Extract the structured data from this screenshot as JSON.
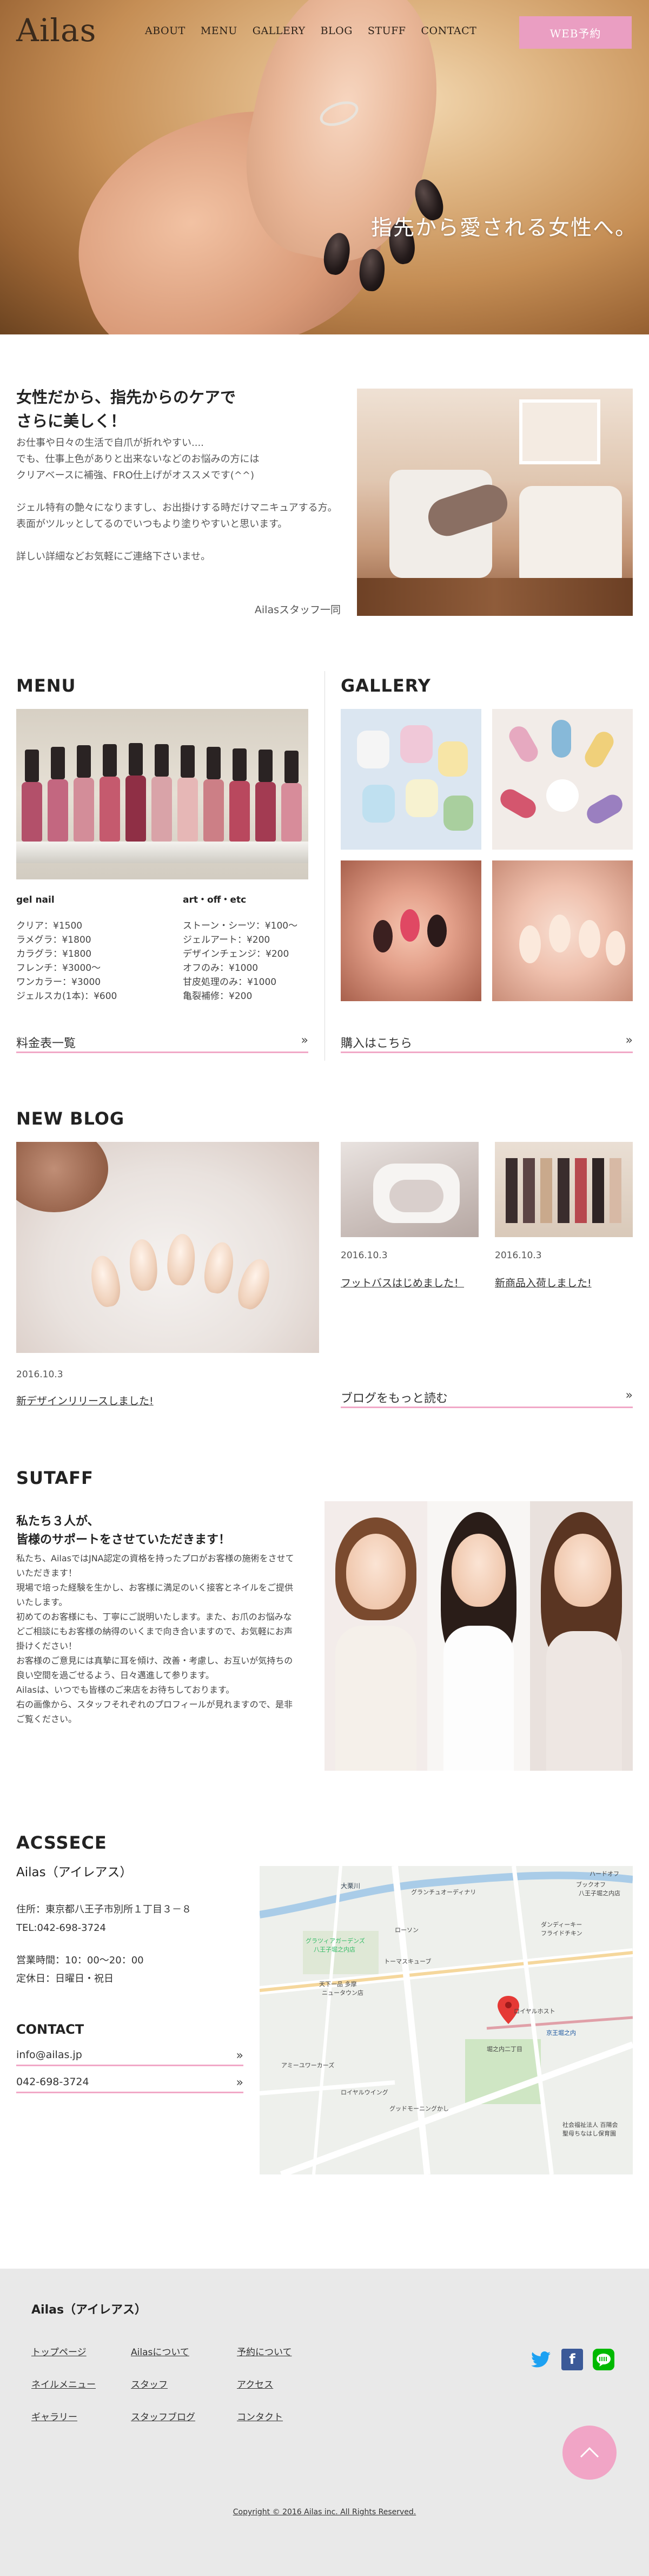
{
  "header": {
    "logo": "Ailas",
    "nav": [
      "ABOUT",
      "MENU",
      "GALLERY",
      "BLOG",
      "STUFF",
      "CONTACT"
    ],
    "reserve_button": "WEB予約"
  },
  "hero": {
    "tagline": "指先から愛される女性へ。"
  },
  "intro": {
    "title_line1": "女性だから、指先からのケアで",
    "title_line2": "さらに美しく！",
    "p1": "お仕事や日々の生活で自爪が折れやすい....\nでも、仕事上色がありと出来ないなどのお悩みの方には\nクリアベースに補強、FRO仕上げがオススメです(^^)",
    "p2": "ジェル特有の艶々になりますし、お出掛けする時だけマニキュアする方。表面がツルッとしてるのでいつもより塗りやすいと思います。",
    "p3": "詳しい詳細などお気軽にご連絡下さいませ。",
    "signature": "Ailasスタッフ一同"
  },
  "menu": {
    "heading": "MENU",
    "gel": {
      "title": "gel nail",
      "items": [
        "クリア：¥1500",
        "ラメグラ：¥1800",
        "カラグラ：¥1800",
        "フレンチ：¥3000〜",
        "ワンカラー：¥3000",
        "ジェルスカ(1本)：¥600"
      ]
    },
    "art": {
      "title": "art・off・etc",
      "items": [
        "ストーン・シーツ：¥100〜",
        "ジェルアート：¥200",
        "デザインチェンジ：¥200",
        "オフのみ：¥1000",
        "甘皮処理のみ：¥1000",
        "亀裂補修：¥200"
      ]
    },
    "link": "料金表一覧"
  },
  "gallery": {
    "heading": "GALLERY",
    "link": "購入はこちら"
  },
  "blog": {
    "heading": "NEW BLOG",
    "posts": [
      {
        "date": "2016.10.3",
        "title": "新デザインリリースしました!"
      },
      {
        "date": "2016.10.3",
        "title": "フットバスはじめました！"
      },
      {
        "date": "2016.10.3",
        "title": "新商品入荷しました!"
      }
    ],
    "more_link": "ブログをもっと読む"
  },
  "staff": {
    "heading": "SUTAFF",
    "title_line1": "私たち３人が、",
    "title_line2": "皆様のサポートをさせていただきます！",
    "body": [
      "私たち、AilasではJNA認定の資格を持ったプロがお客様の施術をさせていただきます！",
      "現場で培った経験を生かし、お客様に満足のいく接客とネイルをご提供いたします。",
      "初めてのお客様にも、丁寧にご説明いたします。また、お爪のお悩みなどご相談にもお客様の納得のいくまで向き合いますので、お気軽にお声掛けください！",
      "お客様のご意見には真摯に耳を傾け、改善・考慮し、お互いが気持ちの良い空間を過ごせるよう、日々邁進して参ります。",
      "Ailasは、いつでも皆様のご来店をお待ちしております。",
      "右の画像から、スタッフそれぞれのプロフィールが見れますので、是非ご覧ください。"
    ]
  },
  "access": {
    "heading": "ACSSECE",
    "name": "Ailas（アイレアス）",
    "address": "住所：東京都八王子市別所１丁目３－８",
    "tel": "TEL:042-698-3724",
    "hours": "営業時間：10：00〜20：00",
    "holiday": "定休日：日曜日・祝日",
    "contact_heading": "CONTACT",
    "email": "info@ailas.jp",
    "phone": "042-698-3724"
  },
  "map": {
    "labels": [
      "大栗川",
      "ハードオフ",
      "ブックオフ",
      "八王子堀之内店",
      "ローソン",
      "グランチュオーディナリ",
      "グラツィアガーデンズ",
      "八王子堀之内店",
      "トーマスキューブ",
      "ダンディーキー",
      "フライドチキン",
      "天下一品 多摩",
      "ニュータウン店",
      "ロイヤルウイング",
      "アミーユワーカーズ",
      "社会福祉法人 百陽会",
      "聖母ちなはし保育園",
      "堀之内二丁目",
      "京王堀之内",
      "ロイヤルホスト",
      "グッドモーニングかし"
    ],
    "road_color": "#ffffff",
    "park_color": "#cfe6c4",
    "water_color": "#a9cce8",
    "pin_color": "#e53935"
  },
  "footer": {
    "title": "Ailas（アイレアス）",
    "links": [
      "トップページ",
      "Ailasについて",
      "予約について",
      "ネイルメニュー",
      "スタッフ",
      "アクセス",
      "ギャラリー",
      "スタッフブログ",
      "コンタクト"
    ],
    "copyright": "Copyright © 2016 Ailas inc. All Rights Reserved."
  },
  "colors": {
    "accent": "#ea9ec2",
    "accent_line": "#f1a8c7",
    "twitter": "#1da1f2",
    "facebook": "#3b5998",
    "line": "#00b900"
  },
  "icons": [
    "chevron-right-icon",
    "twitter-icon",
    "facebook-icon",
    "line-icon",
    "chevron-up-icon",
    "map-pin-icon"
  ]
}
